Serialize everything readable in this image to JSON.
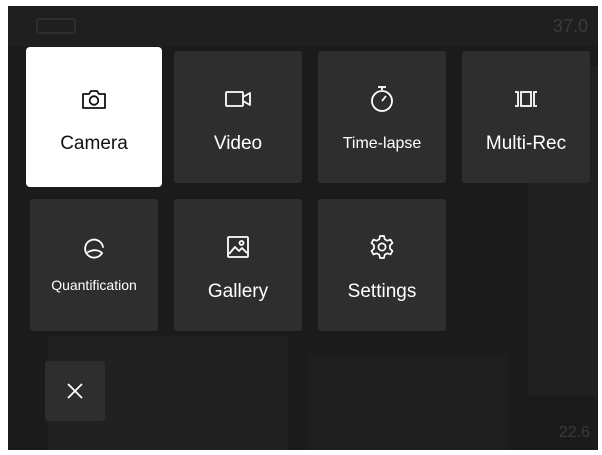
{
  "status": {
    "top_right": "37.0",
    "bottom_right": "22.6"
  },
  "menu": {
    "active": "camera",
    "items": [
      {
        "id": "camera",
        "label": "Camera",
        "icon": "camera-icon"
      },
      {
        "id": "video",
        "label": "Video",
        "icon": "video-camera-icon"
      },
      {
        "id": "time-lapse",
        "label": "Time-lapse",
        "icon": "timer-icon"
      },
      {
        "id": "multi-rec",
        "label": "Multi-Rec",
        "icon": "multi-rec-icon"
      },
      {
        "id": "quantification",
        "label": "Quantification",
        "icon": "quantification-icon"
      },
      {
        "id": "gallery",
        "label": "Gallery",
        "icon": "image-icon"
      },
      {
        "id": "settings",
        "label": "Settings",
        "icon": "gear-icon"
      }
    ],
    "close_icon": "close-icon"
  },
  "colors": {
    "background": "#1b1b1b",
    "tile": "#2e2e2e",
    "active_tile": "#ffffff",
    "text": "#ffffff",
    "active_text": "#111111"
  }
}
